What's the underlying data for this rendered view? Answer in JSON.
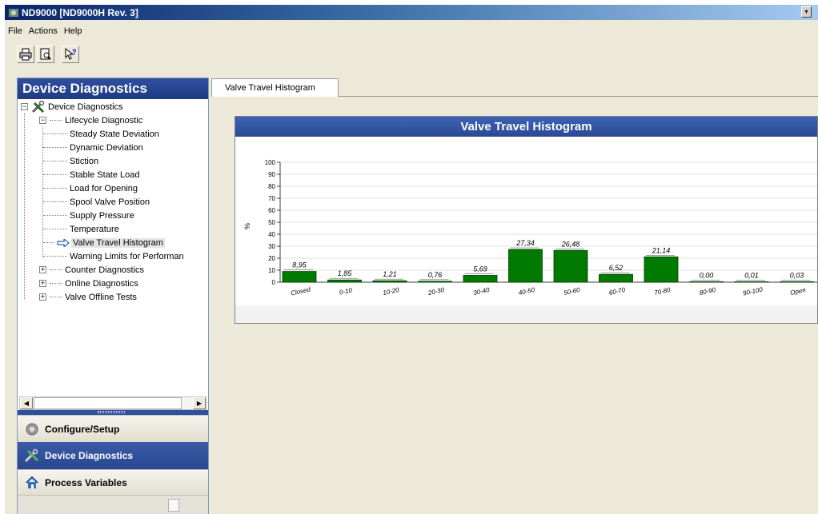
{
  "window": {
    "title": "ND9000 [ND9000H Rev. 3]",
    "dropdown_glyph": "▾"
  },
  "menu": [
    "File",
    "Actions",
    "Help"
  ],
  "toolbar": {
    "icons": [
      "print-icon",
      "print-preview-icon",
      "context-help-icon"
    ]
  },
  "left_panel": {
    "header": "Device Diagnostics",
    "tree": {
      "root": "Device Diagnostics",
      "lifecycle": "Lifecycle Diagnostic",
      "lifecycle_items": [
        "Steady State Deviation",
        "Dynamic Deviation",
        "Stiction",
        "Stable State Load",
        "Load for Opening",
        "Spool Valve Position",
        "Supply Pressure",
        "Temperature",
        "Valve Travel Histogram",
        "Warning Limits for Performan"
      ],
      "other_groups": [
        "Counter Diagnostics",
        "Online Diagnostics",
        "Valve Offline Tests"
      ],
      "selected": "Valve Travel Histogram"
    },
    "nav": {
      "configure": "Configure/Setup",
      "diagnostics": "Device Diagnostics",
      "process": "Process Variables"
    }
  },
  "tab": {
    "label": "Valve Travel Histogram"
  },
  "chart": {
    "header": "Valve Travel Histogram",
    "ylabel": "%",
    "bar_color": "#007a00"
  },
  "chart_data": {
    "type": "bar",
    "title": "Valve Travel Histogram",
    "ylabel": "%",
    "xlabel": "",
    "ylim": [
      0,
      100
    ],
    "yticks": [
      0,
      10,
      20,
      30,
      40,
      50,
      60,
      70,
      80,
      90,
      100
    ],
    "categories": [
      "Closed",
      "0-10",
      "10-20",
      "20-30",
      "30-40",
      "40-50",
      "50-60",
      "60-70",
      "70-80",
      "80-90",
      "90-100",
      "Open"
    ],
    "values": [
      8.95,
      1.85,
      1.21,
      0.76,
      5.69,
      27.34,
      26.48,
      6.52,
      21.14,
      0.0,
      0.01,
      0.03
    ],
    "value_labels": [
      "8,95",
      "1,85",
      "1,21",
      "0,76",
      "5,69",
      "27,34",
      "26,48",
      "6,52",
      "21,14",
      "0,00",
      "0,01",
      "0,03"
    ],
    "grid": true
  }
}
